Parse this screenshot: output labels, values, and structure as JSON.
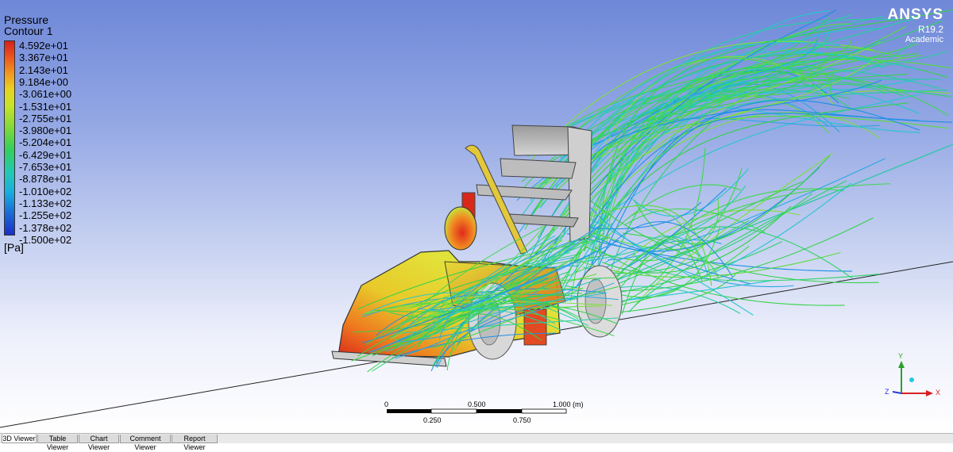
{
  "legend": {
    "title": "Pressure",
    "subtitle": "Contour 1",
    "unit": "[Pa]",
    "labels": [
      "4.592e+01",
      "3.367e+01",
      "2.143e+01",
      "9.184e+00",
      "-3.061e+00",
      "-1.531e+01",
      "-2.755e+01",
      "-3.980e+01",
      "-5.204e+01",
      "-6.429e+01",
      "-7.653e+01",
      "-8.878e+01",
      "-1.010e+02",
      "-1.133e+02",
      "-1.255e+02",
      "-1.378e+02",
      "-1.500e+02"
    ]
  },
  "brand": {
    "name": "ANSYS",
    "version": "R19.2",
    "edition": "Academic"
  },
  "scale_bar": {
    "top_ticks": [
      "0",
      "0.500",
      "1.000"
    ],
    "unit": "(m)",
    "bottom_ticks": [
      "0.250",
      "0.750"
    ]
  },
  "axes": {
    "x": "X",
    "y": "Y",
    "z": "Z"
  },
  "tabs": [
    "3D Viewer",
    "Table Viewer",
    "Chart Viewer",
    "Comment Viewer",
    "Report Viewer"
  ],
  "active_tab": "3D Viewer"
}
